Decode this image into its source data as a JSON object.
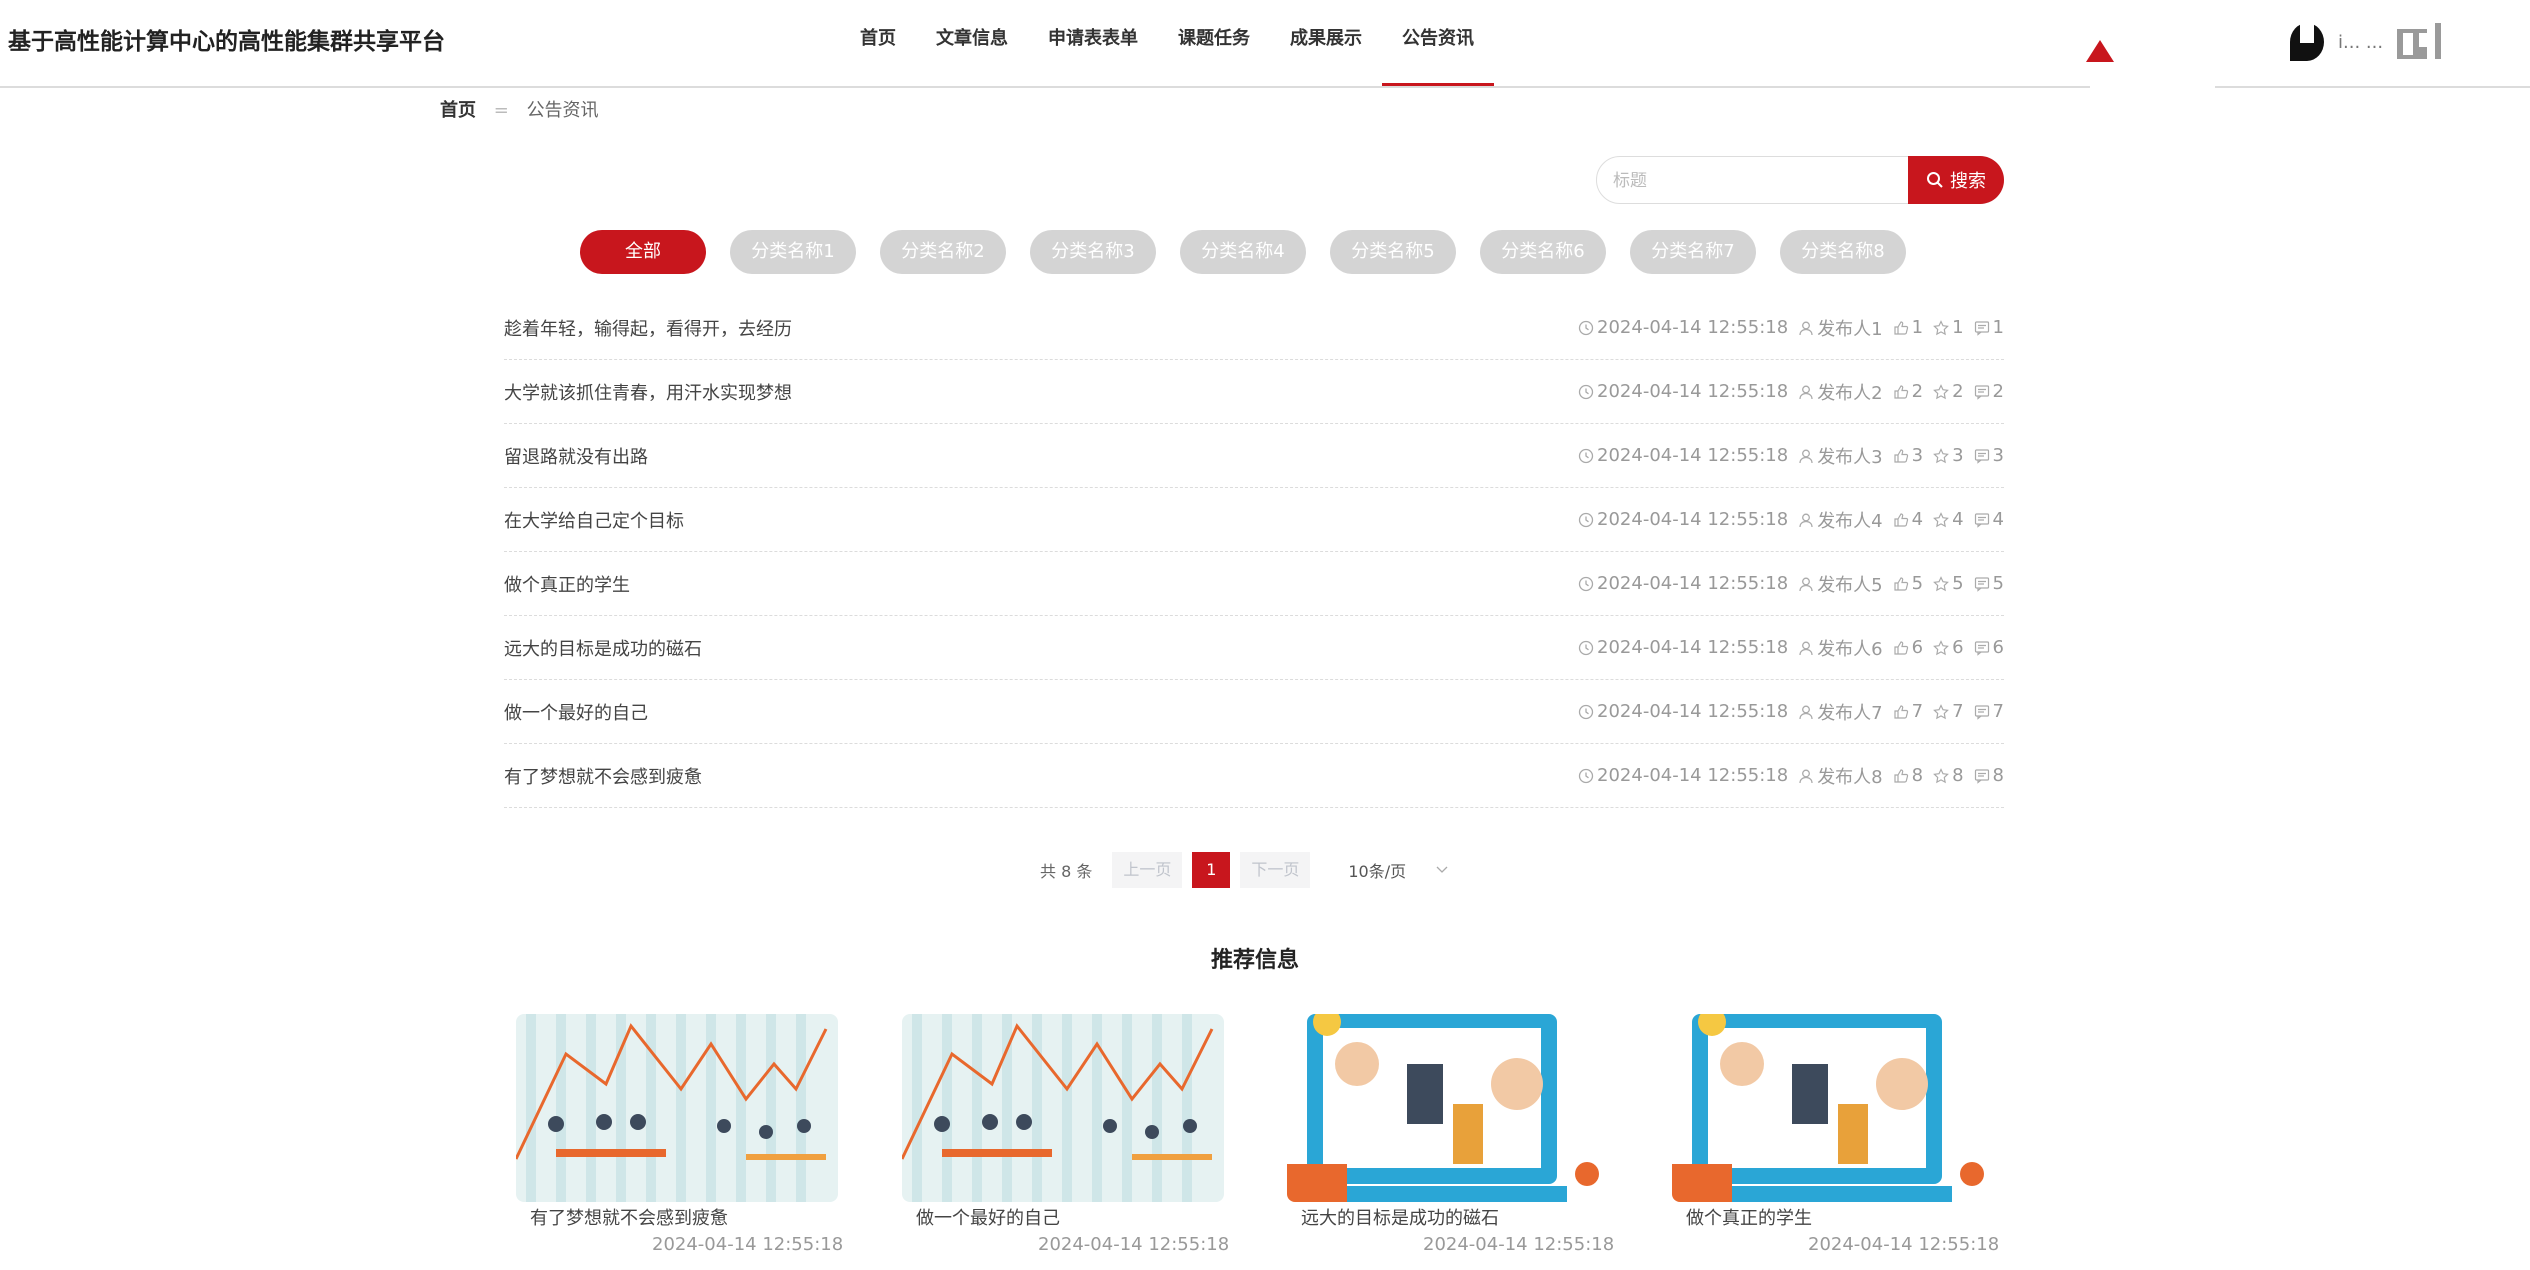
{
  "header": {
    "site_title": "基于高性能计算中心的高性能集群共享平台",
    "nav": [
      "首页",
      "文章信息",
      "申请表表单",
      "课题任务",
      "成果展示",
      "公告资讯"
    ],
    "active_nav": 5,
    "user_name": "i... ...",
    "accent_color": "#c8161d"
  },
  "breadcrumb": {
    "home": "首页",
    "separator": "=",
    "current": "公告资讯"
  },
  "search": {
    "placeholder": "标题",
    "button": "搜索"
  },
  "categories": [
    "全部",
    "分类名称1",
    "分类名称2",
    "分类名称3",
    "分类名称4",
    "分类名称5",
    "分类名称6",
    "分类名称7",
    "分类名称8"
  ],
  "articles": [
    {
      "title": "趁着年轻，输得起，看得开，去经历",
      "time": "2024-04-14 12:55:18",
      "author": "发布人1",
      "likes": "1",
      "favorites": "1",
      "comments": "1"
    },
    {
      "title": "大学就该抓住青春，用汗水实现梦想",
      "time": "2024-04-14 12:55:18",
      "author": "发布人2",
      "likes": "2",
      "favorites": "2",
      "comments": "2"
    },
    {
      "title": "留退路就没有出路",
      "time": "2024-04-14 12:55:18",
      "author": "发布人3",
      "likes": "3",
      "favorites": "3",
      "comments": "3"
    },
    {
      "title": "在大学给自己定个目标",
      "time": "2024-04-14 12:55:18",
      "author": "发布人4",
      "likes": "4",
      "favorites": "4",
      "comments": "4"
    },
    {
      "title": "做个真正的学生",
      "time": "2024-04-14 12:55:18",
      "author": "发布人5",
      "likes": "5",
      "favorites": "5",
      "comments": "5"
    },
    {
      "title": "远大的目标是成功的磁石",
      "time": "2024-04-14 12:55:18",
      "author": "发布人6",
      "likes": "6",
      "favorites": "6",
      "comments": "6"
    },
    {
      "title": "做一个最好的自己",
      "time": "2024-04-14 12:55:18",
      "author": "发布人7",
      "likes": "7",
      "favorites": "7",
      "comments": "7"
    },
    {
      "title": "有了梦想就不会感到疲惫",
      "time": "2024-04-14 12:55:18",
      "author": "发布人8",
      "likes": "8",
      "favorites": "8",
      "comments": "8"
    }
  ],
  "pagination": {
    "total": "共 8 条",
    "prev": "上一页",
    "current": "1",
    "next": "下一页",
    "page_size": "10条/页"
  },
  "recommend": {
    "title": "推荐信息",
    "items": [
      {
        "title": "有了梦想就不会感到疲惫",
        "time": "2024-04-14 12:55:18",
        "image": "team-meeting-chart-illustration"
      },
      {
        "title": "做一个最好的自己",
        "time": "2024-04-14 12:55:18",
        "image": "team-meeting-chart-illustration"
      },
      {
        "title": "远大的目标是成功的磁石",
        "time": "2024-04-14 12:55:18",
        "image": "online-education-computer-illustration"
      },
      {
        "title": "做个真正的学生",
        "time": "2024-04-14 12:55:18",
        "image": "online-education-computer-illustration"
      }
    ]
  }
}
